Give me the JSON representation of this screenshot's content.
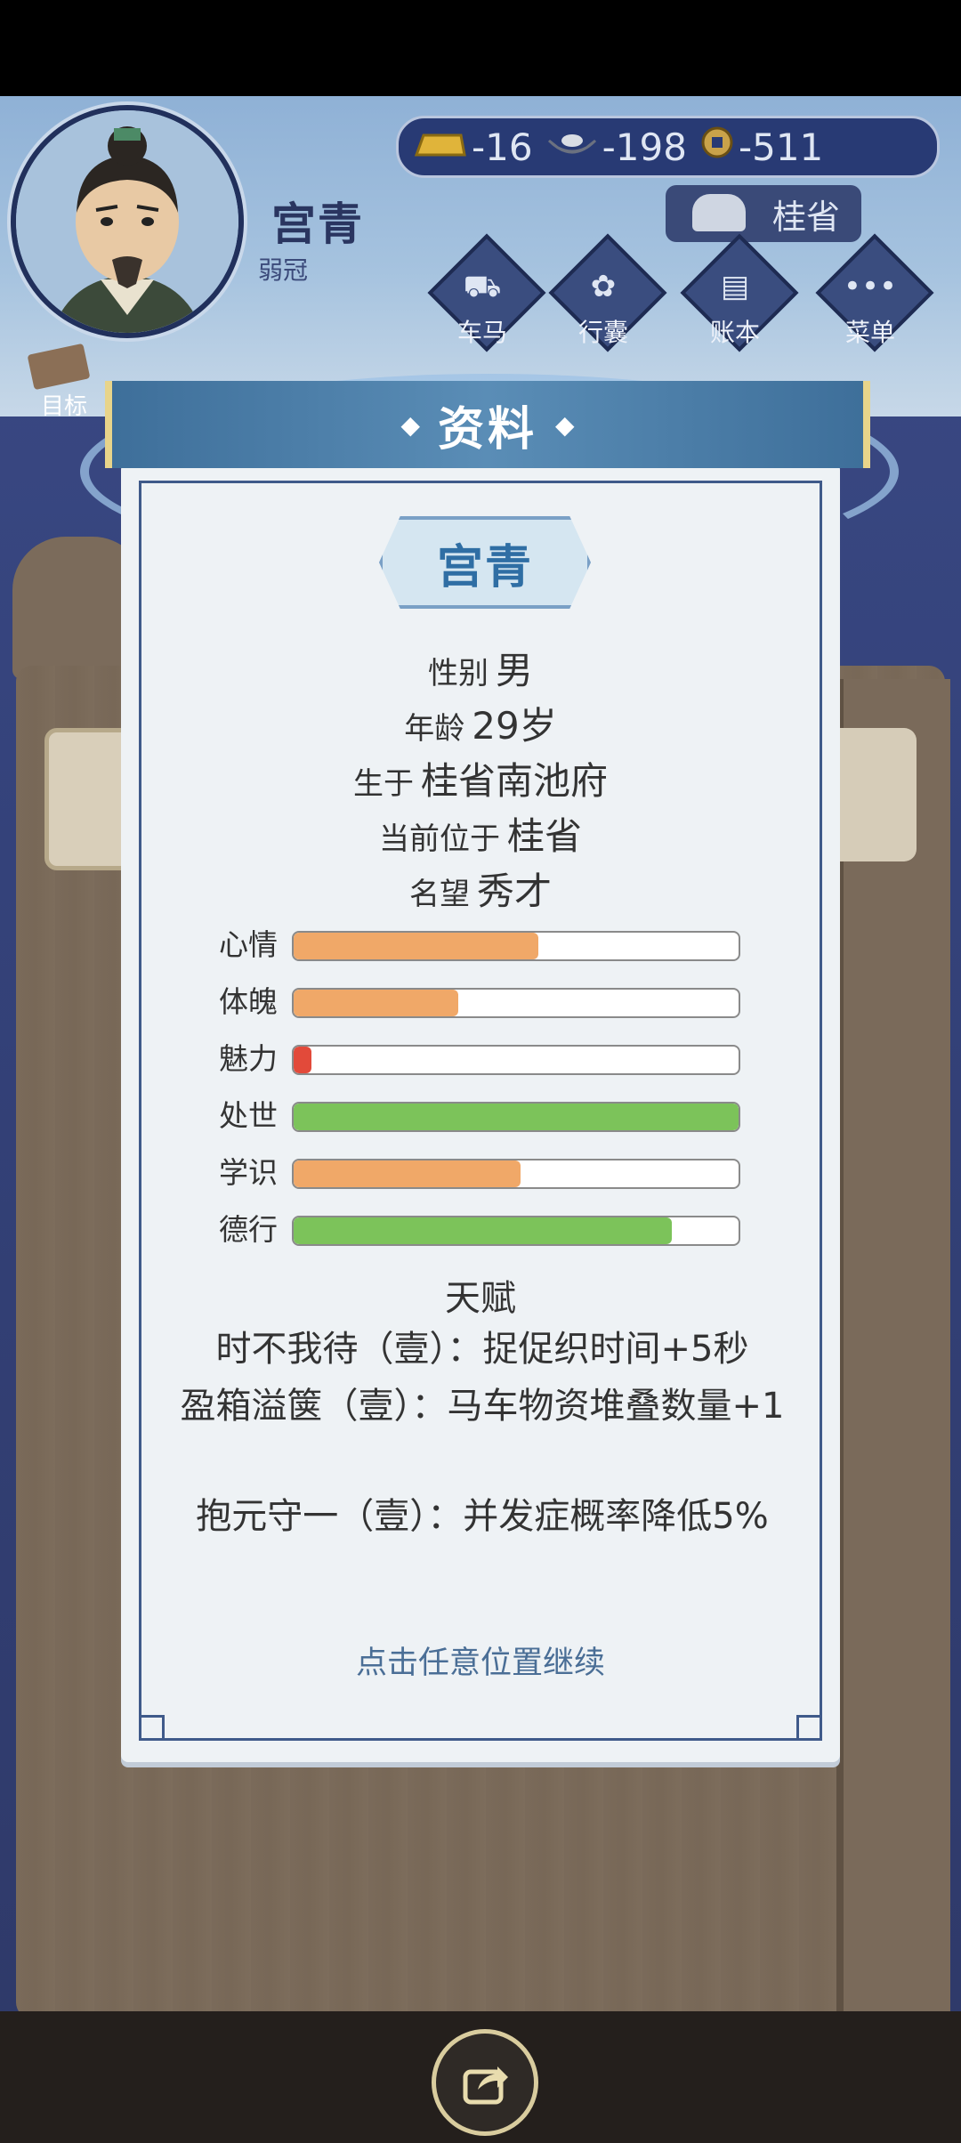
{
  "header": {
    "player_name": "宫青",
    "player_title": "弱冠",
    "location": "桂省",
    "goal_label": "目标"
  },
  "currency": {
    "gold": "-16",
    "silver": "-198",
    "copper": "-511"
  },
  "menu": [
    {
      "label": "车马",
      "icon": "carriage-icon"
    },
    {
      "label": "行囊",
      "icon": "bag-icon"
    },
    {
      "label": "账本",
      "icon": "ledger-icon"
    },
    {
      "label": "菜单",
      "icon": "more-icon"
    }
  ],
  "panel": {
    "title": "资料",
    "name": "宫青",
    "info": [
      {
        "label": "性别",
        "value": "男"
      },
      {
        "label": "年龄",
        "value": "29岁"
      },
      {
        "label": "生于",
        "value": "桂省南池府"
      },
      {
        "label": "当前位于",
        "value": "桂省"
      },
      {
        "label": "名望",
        "value": "秀才"
      }
    ],
    "stats": [
      {
        "label": "心情",
        "level": 0.55,
        "color": "#f0a868"
      },
      {
        "label": "体魄",
        "level": 0.37,
        "color": "#f0a868"
      },
      {
        "label": "魅力",
        "level": 0.04,
        "color": "#e24a3a"
      },
      {
        "label": "处世",
        "level": 1.0,
        "color": "#7cc35a"
      },
      {
        "label": "学识",
        "level": 0.51,
        "color": "#f0a868"
      },
      {
        "label": "德行",
        "level": 0.85,
        "color": "#7cc35a"
      }
    ],
    "talent_title": "天赋",
    "talents": [
      "时不我待（壹）：捉促织时间+5秒",
      "盈箱溢箧（壹）：马车物资堆叠数量+1",
      "抱元守一（壹）：并发症概率降低5%"
    ],
    "continue_hint": "点击任意位置继续"
  }
}
